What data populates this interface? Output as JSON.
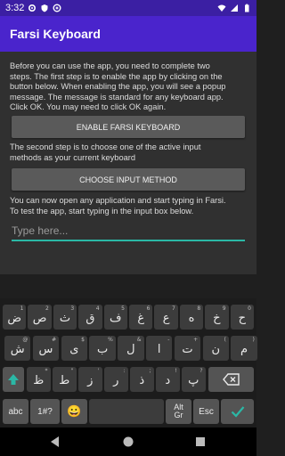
{
  "status_bar": {
    "time": "3:32"
  },
  "app_bar": {
    "title": "Farsi Keyboard"
  },
  "content": {
    "intro_lines": [
      "Before you can use the app, you need to complete two",
      "steps. The first step is to enable the app by clicking on the",
      "button below. When enabling the app, you will see a popup",
      "message. The message is standard for any keyboard app.",
      "Click OK. You may need to click OK again."
    ],
    "enable_button_label": "ENABLE FARSI KEYBOARD",
    "second_step_lines": [
      "The second step is to choose one of the active input",
      "methods as your current keyboard"
    ],
    "choose_button_label": "CHOOSE INPUT METHOD",
    "test_lines": [
      "You can now open any application and start typing in Farsi.",
      "To test the app, start typing in the input box below."
    ],
    "input_placeholder": "Type here...",
    "input_value": ""
  },
  "keyboard": {
    "row1": [
      {
        "main": "ض",
        "hint": "1"
      },
      {
        "main": "ص",
        "hint": "2"
      },
      {
        "main": "ث",
        "hint": "3"
      },
      {
        "main": "ق",
        "hint": "4"
      },
      {
        "main": "ف",
        "hint": "5"
      },
      {
        "main": "غ",
        "hint": "6"
      },
      {
        "main": "ع",
        "hint": "7"
      },
      {
        "main": "ه",
        "hint": "8"
      },
      {
        "main": "خ",
        "hint": "9"
      },
      {
        "main": "ح",
        "hint": "0"
      }
    ],
    "row2": [
      {
        "main": "ش",
        "hint": "@"
      },
      {
        "main": "س",
        "hint": "#"
      },
      {
        "main": "ی",
        "hint": "$"
      },
      {
        "main": "ب",
        "hint": "%"
      },
      {
        "main": "ل",
        "hint": "&"
      },
      {
        "main": "ا",
        "hint": "-"
      },
      {
        "main": "ت",
        "hint": "+"
      },
      {
        "main": "ن",
        "hint": "("
      },
      {
        "main": "م",
        "hint": ")"
      }
    ],
    "row3": [
      {
        "main": "ظ",
        "hint": "*"
      },
      {
        "main": "ط",
        "hint": "\""
      },
      {
        "main": "ز",
        "hint": "'"
      },
      {
        "main": "ر",
        "hint": ":"
      },
      {
        "main": "ذ",
        "hint": ";"
      },
      {
        "main": "د",
        "hint": "!"
      },
      {
        "main": "پ",
        "hint": "?"
      }
    ],
    "abc_label": "abc",
    "symbols_label": "1#?",
    "emoji_label": "😀",
    "altgr_label_1": "Alt",
    "altgr_label_2": "Gr",
    "esc_label": "Esc",
    "accent_color": "#2bb8a6",
    "shift_icon": "shift-arrow-icon",
    "backspace_icon": "backspace-icon",
    "enter_icon": "checkmark-icon"
  },
  "nav_bar": {
    "back_icon": "back-triangle-icon",
    "home_icon": "home-circle-icon",
    "recents_icon": "recents-square-icon"
  }
}
